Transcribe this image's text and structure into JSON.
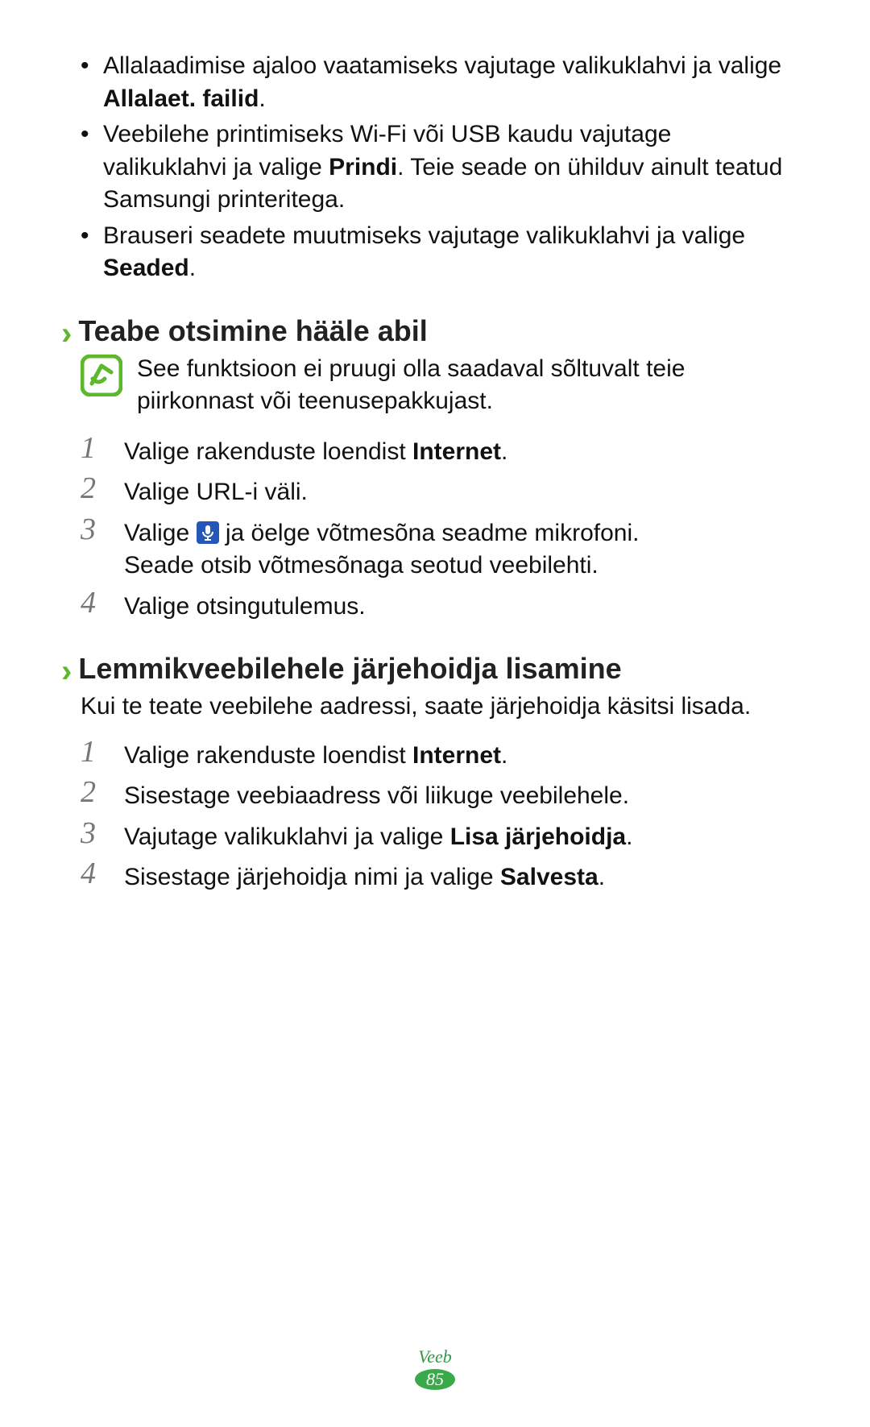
{
  "bullets": [
    {
      "before": "Allalaadimise ajaloo vaatamiseks vajutage valikuklahvi ja valige ",
      "bold": "Allalaet. failid",
      "after": "."
    },
    {
      "before": "Veebilehe printimiseks Wi-Fi või USB kaudu vajutage valikuklahvi ja valige ",
      "bold": "Prindi",
      "after": ". Teie seade on ühilduv ainult teatud Samsungi printeritega."
    },
    {
      "before": "Brauseri seadete muutmiseks vajutage valikuklahvi ja valige ",
      "bold": "Seaded",
      "after": "."
    }
  ],
  "section1": {
    "title": "Teabe otsimine hääle abil",
    "note": "See funktsioon ei pruugi olla saadaval sõltuvalt teie piirkonnast või teenusepakkujast.",
    "steps": [
      {
        "before": "Valige rakenduste loendist ",
        "bold": "Internet",
        "after": "."
      },
      {
        "before": "Valige URL-i väli.",
        "bold": "",
        "after": ""
      },
      {
        "mic": true,
        "beforeMic": "Valige ",
        "afterMic": " ja öelge võtmesõna seadme mikrofoni.",
        "line2": "Seade otsib võtmesõnaga seotud veebilehti."
      },
      {
        "before": "Valige otsingutulemus.",
        "bold": "",
        "after": ""
      }
    ]
  },
  "section2": {
    "title": "Lemmikveebilehele järjehoidja lisamine",
    "intro": "Kui te teate veebilehe aadressi, saate järjehoidja käsitsi lisada.",
    "steps": [
      {
        "before": "Valige rakenduste loendist ",
        "bold": "Internet",
        "after": "."
      },
      {
        "before": "Sisestage veebiaadress või liikuge veebilehele.",
        "bold": "",
        "after": ""
      },
      {
        "before": "Vajutage valikuklahvi ja valige ",
        "bold": "Lisa järjehoidja",
        "after": "."
      },
      {
        "before": "Sisestage järjehoidja nimi ja valige ",
        "bold": "Salvesta",
        "after": "."
      }
    ]
  },
  "footer": {
    "label": "Veeb",
    "page": "85"
  }
}
